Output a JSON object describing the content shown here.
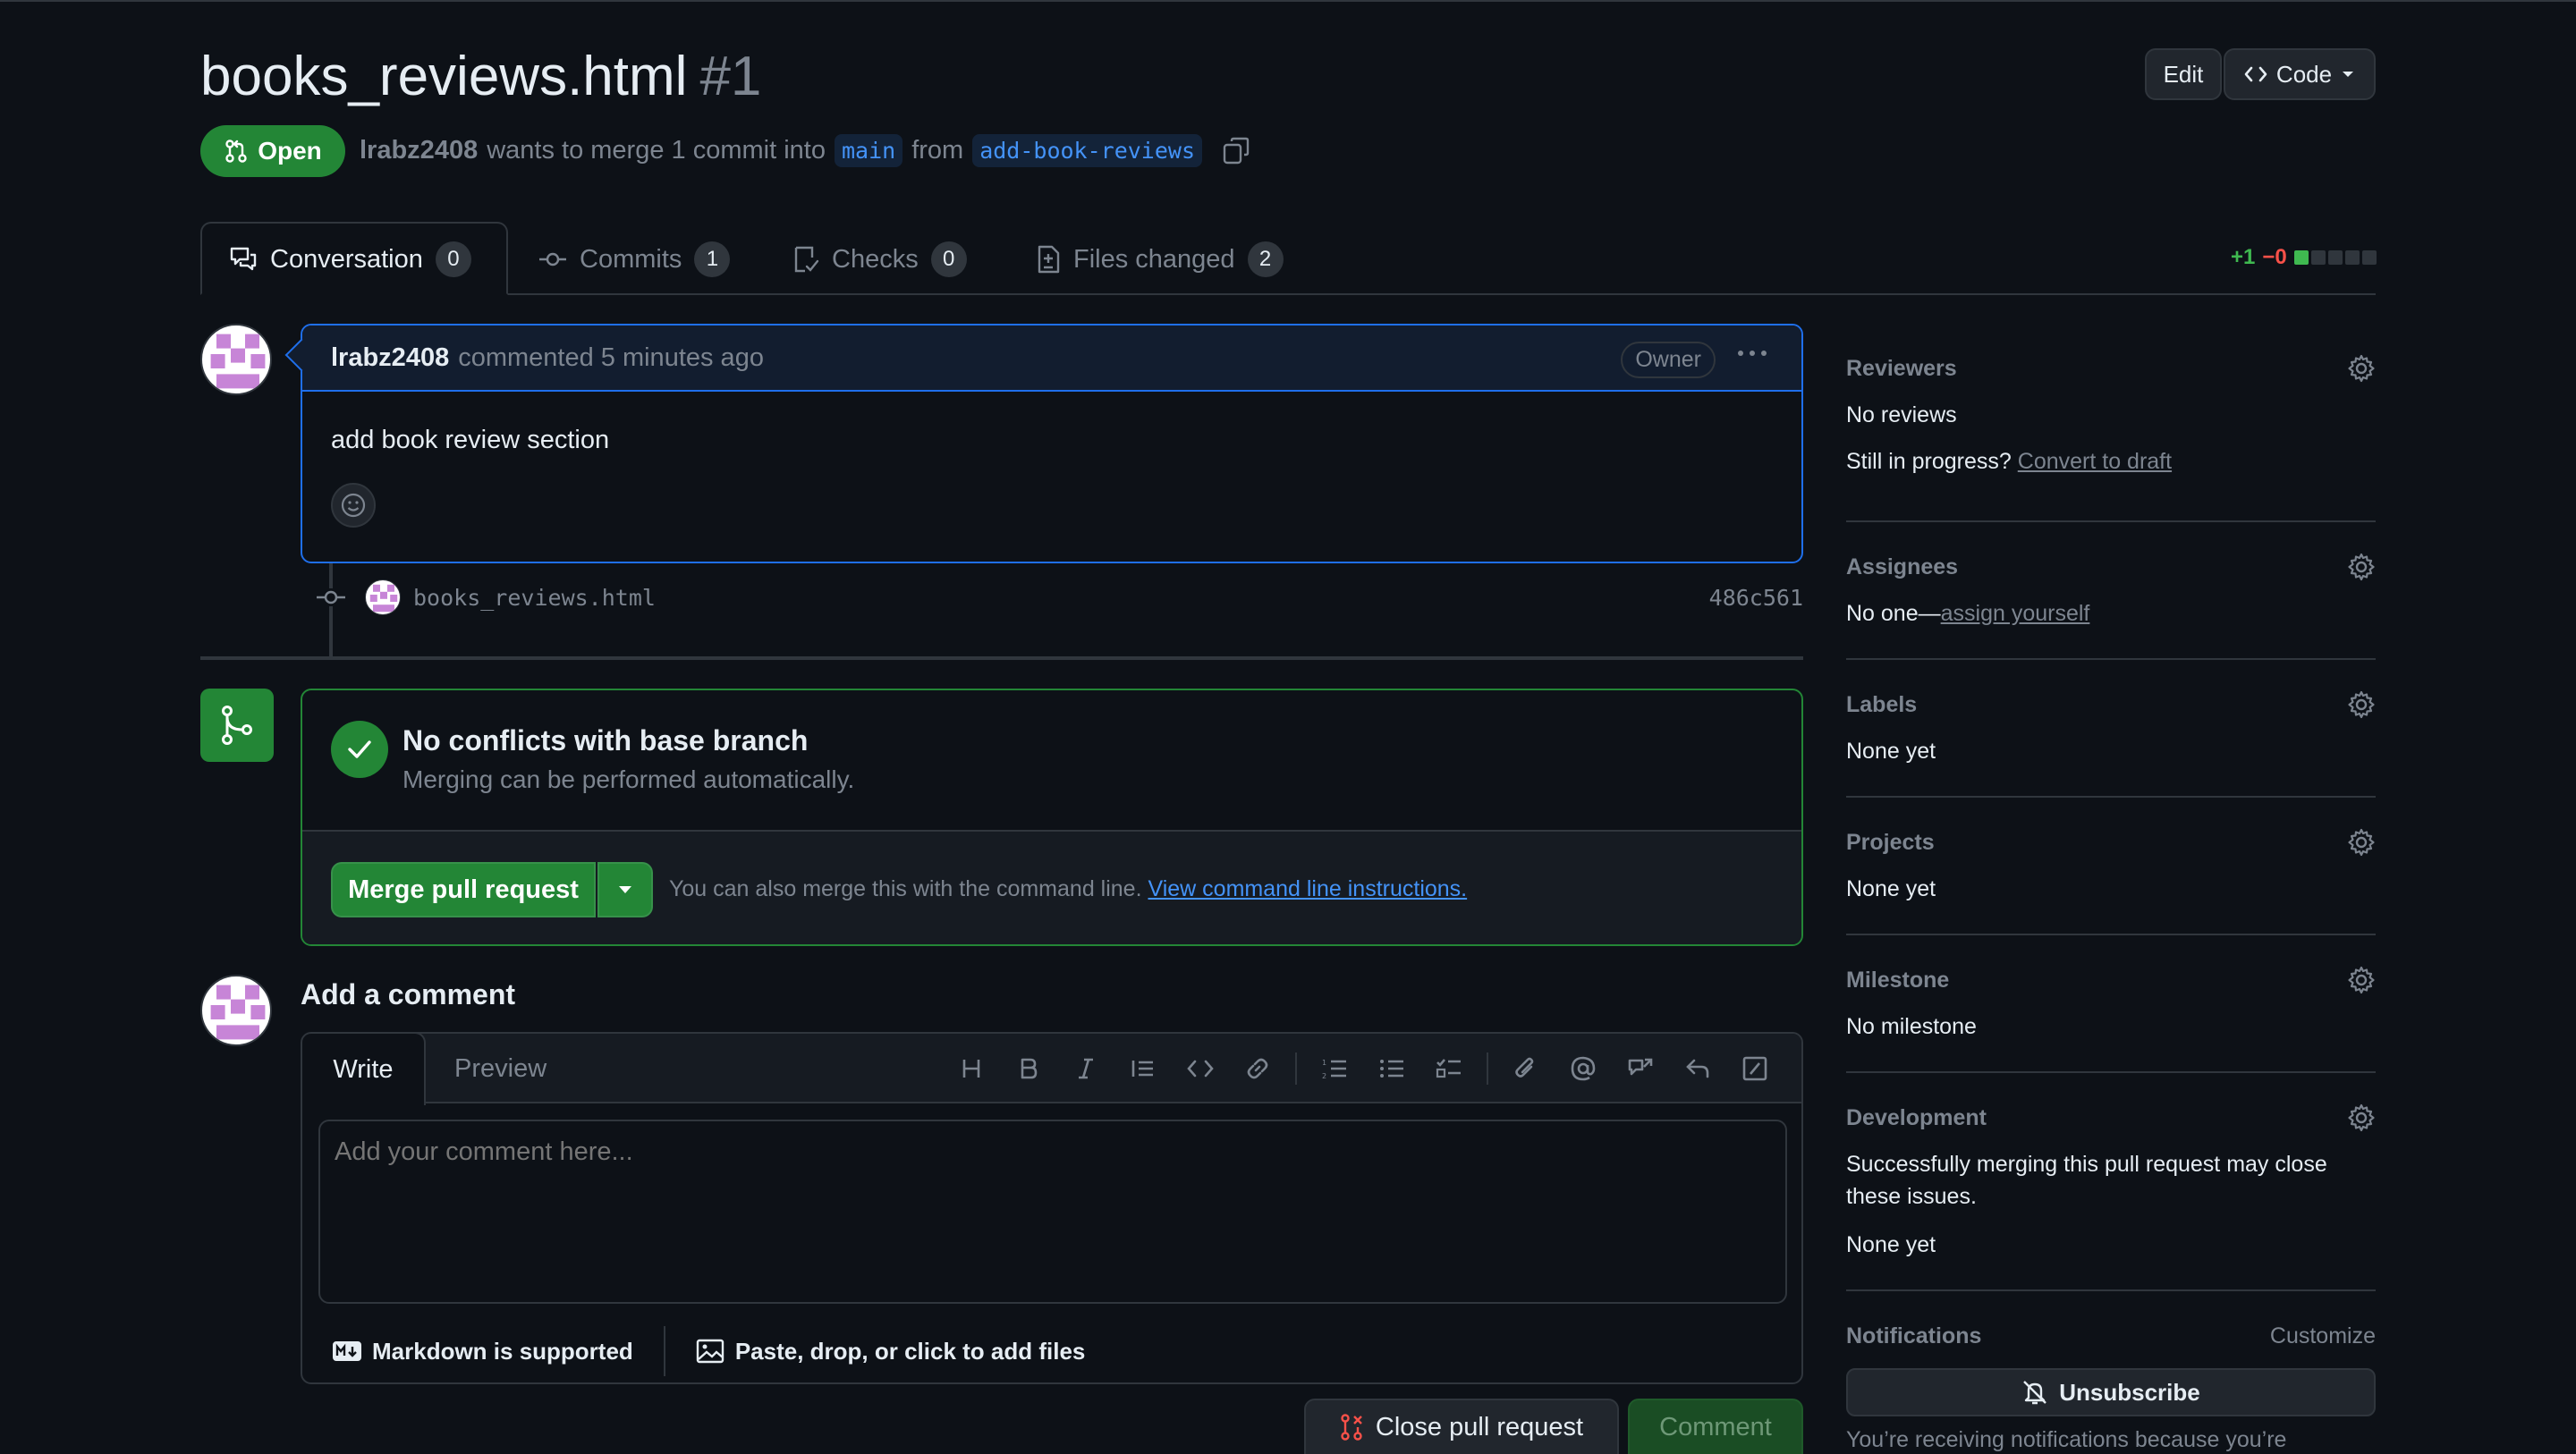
{
  "header": {
    "title": "books_reviews.html",
    "number": "#1",
    "edit_label": "Edit",
    "code_label": "Code",
    "status": "Open",
    "author": "lrabz2408",
    "merge_text_1": "wants to merge 1 commit into",
    "base_branch": "main",
    "from_text": "from",
    "head_branch": "add-book-reviews"
  },
  "tabs": [
    {
      "label": "Conversation",
      "count": "0"
    },
    {
      "label": "Commits",
      "count": "1"
    },
    {
      "label": "Checks",
      "count": "0"
    },
    {
      "label": "Files changed",
      "count": "2"
    }
  ],
  "diffstat": {
    "additions": "+1",
    "deletions": "−0",
    "green_blocks": 1,
    "total_blocks": 5
  },
  "comment": {
    "author": "lrabz2408",
    "meta": "commented 5 minutes ago",
    "badge": "Owner",
    "body": "add book review section"
  },
  "commit": {
    "file": "books_reviews.html",
    "sha": "486c561"
  },
  "merge": {
    "title": "No conflicts with base branch",
    "subtitle": "Merging can be performed automatically.",
    "button": "Merge pull request",
    "note": "You can also merge this with the command line.",
    "note_link": "View command line instructions."
  },
  "add_comment": {
    "title": "Add a comment",
    "write_tab": "Write",
    "preview_tab": "Preview",
    "placeholder": "Add your comment here...",
    "markdown_note": "Markdown is supported",
    "files_note": "Paste, drop, or click to add files",
    "close_button": "Close pull request",
    "comment_button": "Comment"
  },
  "sidebar": {
    "reviewers": {
      "label": "Reviewers",
      "value": "No reviews",
      "draft_prefix": "Still in progress?",
      "draft_link": "Convert to draft"
    },
    "assignees": {
      "label": "Assignees",
      "value_prefix": "No one—",
      "value_link": "assign yourself"
    },
    "labels": {
      "label": "Labels",
      "value": "None yet"
    },
    "projects": {
      "label": "Projects",
      "value": "None yet"
    },
    "milestone": {
      "label": "Milestone",
      "value": "No milestone"
    },
    "development": {
      "label": "Development",
      "description": "Successfully merging this pull request may close these issues.",
      "value": "None yet"
    },
    "notifications": {
      "label": "Notifications",
      "customize": "Customize",
      "unsubscribe": "Unsubscribe",
      "note": "You’re receiving notifications because you’re"
    }
  },
  "colors": {
    "accent_green": "#238636",
    "link_blue": "#4493f8",
    "bg": "#0d1117"
  }
}
